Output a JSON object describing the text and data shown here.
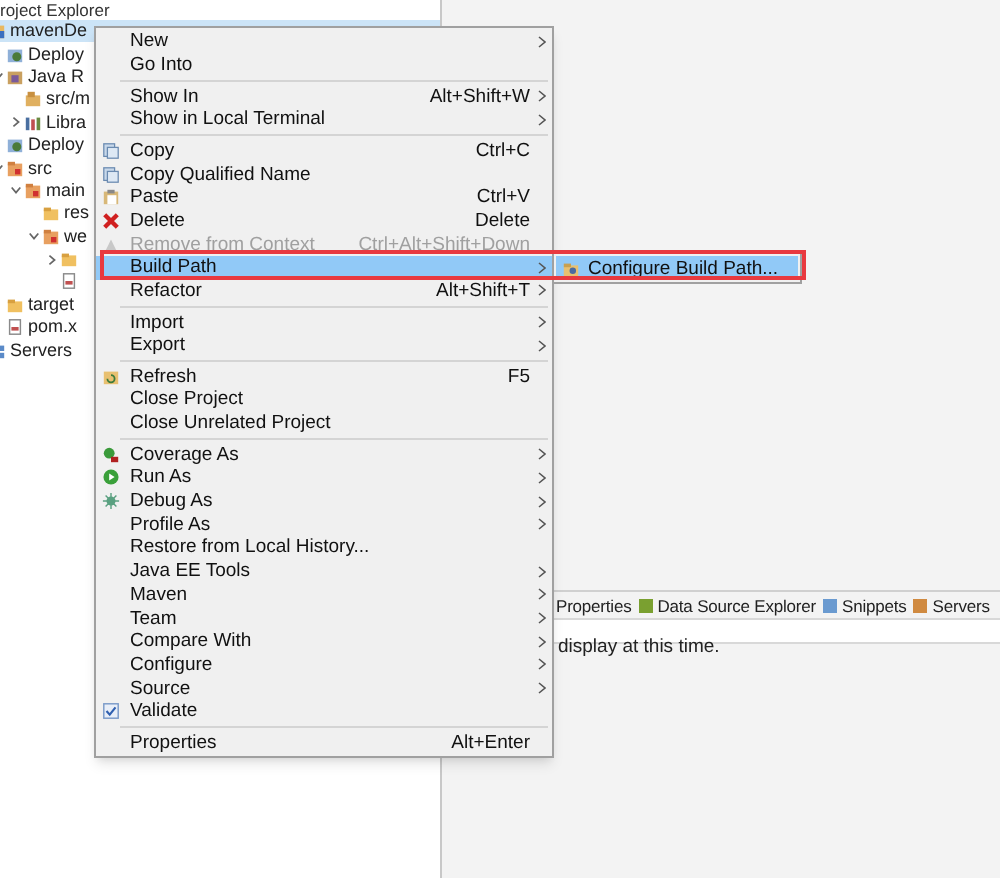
{
  "explorer": {
    "title": "roject Explorer",
    "tree": [
      {
        "label": "mavenDe",
        "kind": "project",
        "selected": true,
        "children": [
          {
            "label": "Deploy",
            "kind": "deploy",
            "selected": false
          },
          {
            "label": "Java R",
            "kind": "java-res",
            "expanded": true,
            "selected": false,
            "children": [
              {
                "label": "src/m",
                "kind": "package",
                "selected": false
              },
              {
                "label": "Libra",
                "kind": "library",
                "expanded": false,
                "selected": false
              }
            ]
          },
          {
            "label": "Deploy",
            "kind": "deploy",
            "selected": false
          },
          {
            "label": "src",
            "kind": "src",
            "expanded": true,
            "selected": false,
            "children": [
              {
                "label": "main",
                "kind": "src",
                "expanded": true,
                "selected": false,
                "children": [
                  {
                    "label": "res",
                    "kind": "folder",
                    "selected": false
                  },
                  {
                    "label": "we",
                    "kind": "src",
                    "expanded": true,
                    "selected": false,
                    "children": [
                      {
                        "kind": "folder",
                        "expanded": false,
                        "selected": false
                      },
                      {
                        "kind": "file",
                        "selected": false
                      }
                    ]
                  }
                ]
              }
            ]
          },
          {
            "label": "target",
            "kind": "folder",
            "selected": false
          },
          {
            "label": "pom.x",
            "kind": "file",
            "selected": false
          }
        ]
      },
      {
        "label": "Servers",
        "kind": "servers",
        "selected": false
      }
    ]
  },
  "context_menu": {
    "groups": [
      [
        {
          "label": "New",
          "submenu": true,
          "selected": false
        },
        {
          "label": "Go Into",
          "selected": false
        }
      ],
      [
        {
          "label": "Show In",
          "shortcut": "Alt+Shift+W",
          "submenu": true,
          "selected": false
        },
        {
          "label": "Show in Local Terminal",
          "submenu": true,
          "selected": false
        }
      ],
      [
        {
          "label": "Copy",
          "shortcut": "Ctrl+C",
          "selected": false
        },
        {
          "label": "Copy Qualified Name",
          "selected": false
        },
        {
          "label": "Paste",
          "shortcut": "Ctrl+V",
          "selected": false
        },
        {
          "label": "Delete",
          "shortcut": "Delete",
          "selected": false
        },
        {
          "label": "Remove from Context",
          "shortcut": "Ctrl+Alt+Shift+Down",
          "disabled": true,
          "selected": false
        },
        {
          "label": "Build Path",
          "submenu": true,
          "selected": true
        },
        {
          "label": "Refactor",
          "shortcut": "Alt+Shift+T",
          "submenu": true,
          "selected": false
        }
      ],
      [
        {
          "label": "Import",
          "submenu": true,
          "selected": false
        },
        {
          "label": "Export",
          "submenu": true,
          "selected": false
        }
      ],
      [
        {
          "label": "Refresh",
          "shortcut": "F5",
          "selected": false
        },
        {
          "label": "Close Project",
          "selected": false
        },
        {
          "label": "Close Unrelated Project",
          "selected": false
        }
      ],
      [
        {
          "label": "Coverage As",
          "submenu": true,
          "selected": false
        },
        {
          "label": "Run As",
          "submenu": true,
          "selected": false
        },
        {
          "label": "Debug As",
          "submenu": true,
          "selected": false
        },
        {
          "label": "Profile As",
          "submenu": true,
          "selected": false
        },
        {
          "label": "Restore from Local History...",
          "selected": false
        },
        {
          "label": "Java EE Tools",
          "submenu": true,
          "selected": false
        },
        {
          "label": "Maven",
          "submenu": true,
          "selected": false
        },
        {
          "label": "Team",
          "submenu": true,
          "selected": false
        },
        {
          "label": "Compare With",
          "submenu": true,
          "selected": false
        },
        {
          "label": "Configure",
          "submenu": true,
          "selected": false
        },
        {
          "label": "Source",
          "submenu": true,
          "selected": false
        },
        {
          "label": "Validate",
          "checked": true,
          "selected": false
        }
      ],
      [
        {
          "label": "Properties",
          "shortcut": "Alt+Enter",
          "selected": false
        }
      ]
    ]
  },
  "submenu": {
    "items": [
      {
        "label": "Configure Build Path...",
        "selected": true
      }
    ]
  },
  "bottom_view": {
    "tabs": [
      {
        "label": "Properties"
      },
      {
        "label": "Data Source Explorer"
      },
      {
        "label": "Snippets"
      },
      {
        "label": "Servers"
      }
    ],
    "message": "display at this time."
  }
}
